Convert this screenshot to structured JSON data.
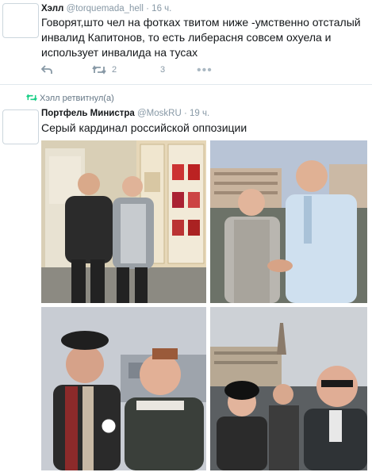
{
  "tweet1": {
    "display_name": "Хэлл",
    "handle": "@torquemada_hell",
    "time": "16 ч.",
    "separator": "·",
    "text": "Говорят,што чел на фотках твитом ниже -умственно отсталый инвалид Капитонов, то есть либерасня совсем охуела и использует инвалида на тусах",
    "retweet_count": "2",
    "like_count": "3"
  },
  "retweet_note": "Хэлл ретвитнул(а)",
  "tweet2": {
    "display_name": "Портфель Министра",
    "handle": "@MoskRU",
    "time": "19 ч.",
    "separator": "·",
    "text": "Серый кардинал российской оппозиции"
  },
  "icons": [
    "reply-icon",
    "retweet-icon",
    "like-icon",
    "more-icon"
  ],
  "colors": {
    "muted": "#8899a6",
    "retweet_green": "#19cf86",
    "border": "#e1e8ed"
  }
}
